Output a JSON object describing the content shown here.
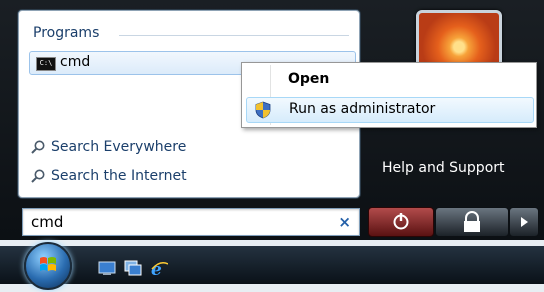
{
  "start_menu": {
    "programs_header": "Programs",
    "program_items": [
      {
        "label": "cmd",
        "icon": "cmd-icon",
        "icon_text": "C:\\"
      }
    ],
    "search_links": [
      {
        "label": "Search Everywhere"
      },
      {
        "label": "Search the Internet"
      }
    ],
    "right_pane": {
      "help_label": "Help and Support"
    },
    "search_box": {
      "value": "cmd",
      "clear_glyph": "×"
    }
  },
  "context_menu": {
    "items": [
      {
        "label": "Open",
        "bold": true
      },
      {
        "label": "Run as administrator",
        "icon": "uac-shield-icon",
        "highlighted": true
      }
    ]
  },
  "colors": {
    "highlight_border": "#9cc3ea",
    "menu_bg": "#ffffff",
    "taskbar": "#0a1118",
    "power_button": "#8a2a2a"
  }
}
